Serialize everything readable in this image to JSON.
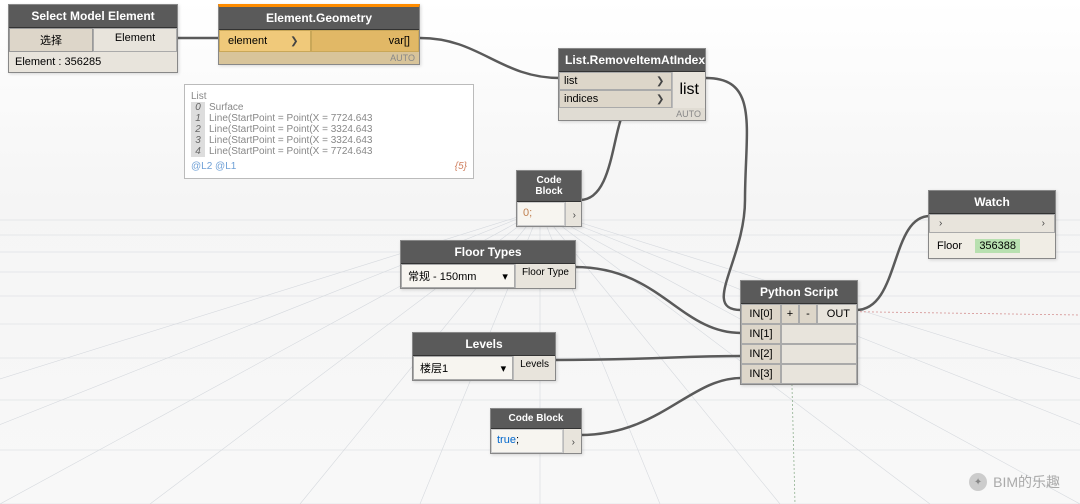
{
  "nodes": {
    "select_model": {
      "title": "Select Model Element",
      "button": "选择",
      "port_out": "Element",
      "result": "Element : 356285"
    },
    "geometry": {
      "title": "Element.Geometry",
      "port_in": "element",
      "port_out": "var[]",
      "lacing": "AUTO"
    },
    "preview": {
      "header": "List",
      "rows": [
        {
          "idx": "0",
          "text": "Surface"
        },
        {
          "idx": "1",
          "text": "Line(StartPoint = Point(X = 7724.643"
        },
        {
          "idx": "2",
          "text": "Line(StartPoint = Point(X = 3324.643"
        },
        {
          "idx": "3",
          "text": "Line(StartPoint = Point(X = 3324.643"
        },
        {
          "idx": "4",
          "text": "Line(StartPoint = Point(X = 7724.643"
        }
      ],
      "footer_left": "@L2 @L1",
      "footer_right": "{5}"
    },
    "remove_item": {
      "title": "List.RemoveItemAtIndex",
      "in1": "list",
      "in2": "indices",
      "out": "list",
      "lacing": "AUTO"
    },
    "code_block_0": {
      "title": "Code Block",
      "code": "0;"
    },
    "floor_types": {
      "title": "Floor Types",
      "value": "常规 - 150mm",
      "port_out": "Floor Type"
    },
    "levels": {
      "title": "Levels",
      "value": "楼层1",
      "port_out": "Levels"
    },
    "code_block_true": {
      "title": "Code Block",
      "code_kw": "true",
      "code_suffix": ";"
    },
    "python": {
      "title": "Python Script",
      "in0": "IN[0]",
      "in1": "IN[1]",
      "in2": "IN[2]",
      "in3": "IN[3]",
      "plus": "+",
      "minus": "-",
      "out": "OUT"
    },
    "watch": {
      "title": "Watch",
      "result_label": "Floor",
      "result_value": "356388"
    }
  },
  "watermark": "BIM的乐趣"
}
